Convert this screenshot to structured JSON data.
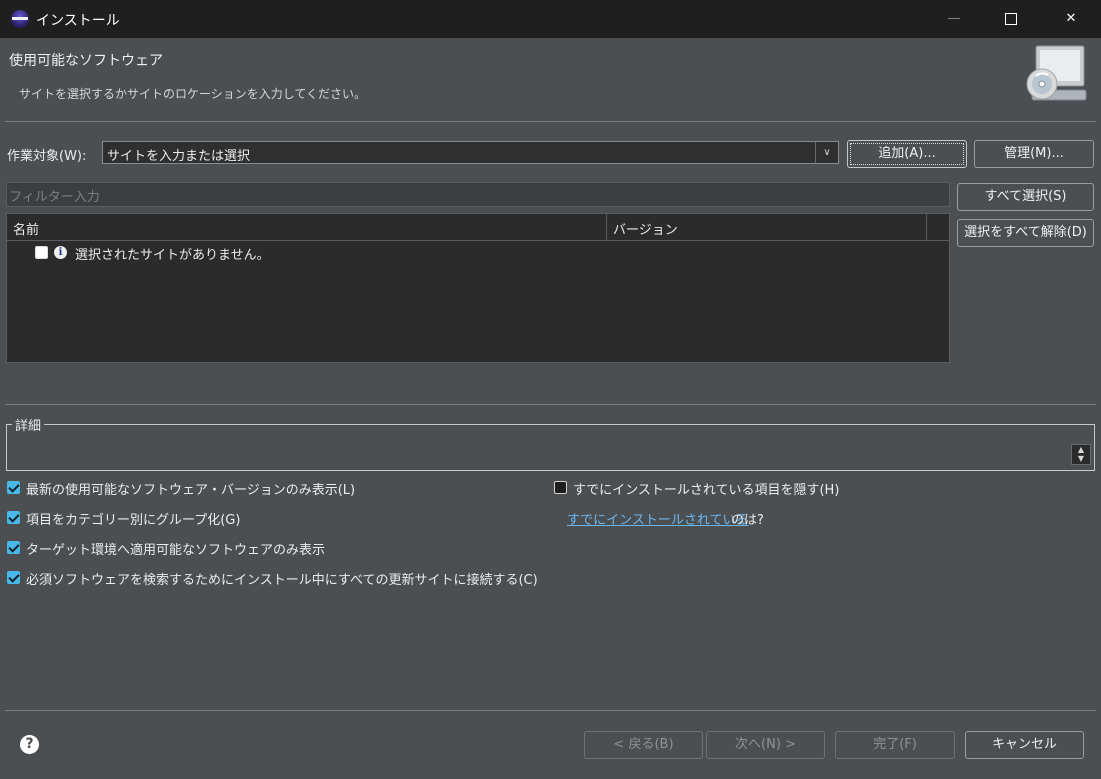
{
  "window": {
    "title": "インストール",
    "minimize_glyph": "—",
    "close_glyph": "✕"
  },
  "header": {
    "title": "使用可能なソフトウェア",
    "description": "サイトを選択するかサイトのロケーションを入力してください。",
    "graphic": "install-wizard-graphic"
  },
  "work_with": {
    "label": "作業対象(W):",
    "value": "サイトを入力または選択",
    "dropdown_glyph": "∨",
    "add_button": "追加(A)...",
    "manage_button": "管理(M)..."
  },
  "filter": {
    "placeholder": "フィルター入力"
  },
  "side_buttons": {
    "select_all": "すべて選択(S)",
    "deselect_all": "選択をすべて解除(D)"
  },
  "table": {
    "columns": [
      "名前",
      "バージョン"
    ],
    "rows": [
      {
        "checked": false,
        "icon": "info-icon",
        "name": "選択されたサイトがありません。",
        "version": ""
      }
    ]
  },
  "details": {
    "legend": "詳細",
    "text": ""
  },
  "options_left": [
    {
      "label": "最新の使用可能なソフトウェア・バージョンのみ表示(L)",
      "checked": true
    },
    {
      "label": "項目をカテゴリー別にグループ化(G)",
      "checked": true
    },
    {
      "label": "ターゲット環境へ適用可能なソフトウェアのみ表示",
      "checked": true
    },
    {
      "label": "必須ソフトウェアを検索するためにインストール中にすべての更新サイトに接続する(C)",
      "checked": true
    }
  ],
  "options_right": {
    "hide_installed": {
      "label": "すでにインストールされている項目を隠す(H)",
      "checked": false
    },
    "whats_installed_link": "すでにインストールされている",
    "whats_installed_suffix": "のは?"
  },
  "footer": {
    "help_glyph": "?",
    "back": "< 戻る(B)",
    "next": "次へ(N) >",
    "finish": "完了(F)",
    "cancel": "キャンセル"
  },
  "colors": {
    "dialog_bg": "#4b4f52",
    "titlebar_bg": "#1f1f1f",
    "checkbox_checked": "#49b7e8",
    "link": "#6cb6f0"
  }
}
